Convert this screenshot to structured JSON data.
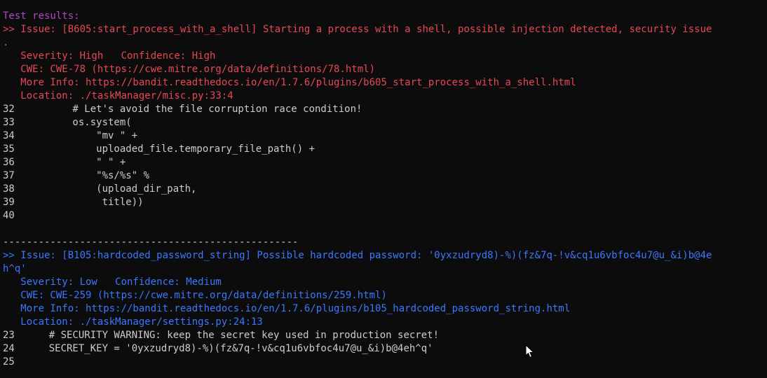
{
  "header": "Test results:",
  "issues": [
    {
      "color": "#e74856",
      "issue_line1": ">> Issue: [B605:start_process_with_a_shell] Starting a process with a shell, possible injection detected, security issue",
      "issue_line2": ".",
      "severity": "   Severity: High   Confidence: High",
      "cwe": "   CWE: CWE-78 (https://cwe.mitre.org/data/definitions/78.html)",
      "more_info": "   More Info: https://bandit.readthedocs.io/en/1.7.6/plugins/b605_start_process_with_a_shell.html",
      "location": "   Location: ./taskManager/misc.py:33:4",
      "code": [
        {
          "num": "32",
          "text": "        # Let's avoid the file corruption race condition!"
        },
        {
          "num": "33",
          "text": "        os.system("
        },
        {
          "num": "34",
          "text": "            \"mv \" +"
        },
        {
          "num": "35",
          "text": "            uploaded_file.temporary_file_path() +"
        },
        {
          "num": "36",
          "text": "            \" \" +"
        },
        {
          "num": "37",
          "text": "            \"%s/%s\" %"
        },
        {
          "num": "38",
          "text": "            (upload_dir_path,"
        },
        {
          "num": "39",
          "text": "             title))"
        },
        {
          "num": "40",
          "text": ""
        }
      ]
    },
    {
      "color": "#3b78ff",
      "issue_line1": ">> Issue: [B105:hardcoded_password_string] Possible hardcoded password: '0yxzudryd8)-%)(fz&7q-!v&cq1u6vbfoc4u7@u_&i)b@4e",
      "issue_line2": "h^q'",
      "severity": "   Severity: Low   Confidence: Medium",
      "cwe": "   CWE: CWE-259 (https://cwe.mitre.org/data/definitions/259.html)",
      "more_info": "   More Info: https://bandit.readthedocs.io/en/1.7.6/plugins/b105_hardcoded_password_string.html",
      "location": "   Location: ./taskManager/settings.py:24:13",
      "code": [
        {
          "num": "23",
          "text": "    # SECURITY WARNING: keep the secret key used in production secret!"
        },
        {
          "num": "24",
          "text": "    SECRET_KEY = '0yxzudryd8)-%)(fz&7q-!v&cq1u6vbfoc4u7@u_&i)b@4eh^q'"
        },
        {
          "num": "25",
          "text": ""
        }
      ]
    }
  ],
  "separator": "--------------------------------------------------",
  "cursor_icon": "mouse-pointer-icon"
}
